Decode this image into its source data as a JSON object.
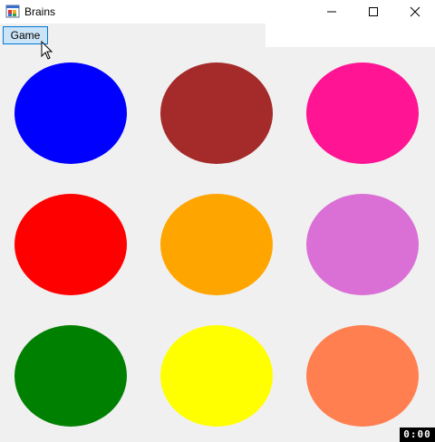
{
  "window": {
    "title": "Brains",
    "icon": "windows-forms-app-icon",
    "controls": [
      "minimize-icon",
      "maximize-icon",
      "close-icon"
    ]
  },
  "menu": {
    "game_label": "Game"
  },
  "circles": [
    {
      "name": "circle-blue",
      "color": "#0000ff"
    },
    {
      "name": "circle-brown",
      "color": "#a52a2a"
    },
    {
      "name": "circle-deep-pink",
      "color": "#ff1493"
    },
    {
      "name": "circle-red",
      "color": "#ff0000"
    },
    {
      "name": "circle-orange",
      "color": "#ffa500"
    },
    {
      "name": "circle-orchid",
      "color": "#da70d6"
    },
    {
      "name": "circle-green",
      "color": "#008000"
    },
    {
      "name": "circle-yellow",
      "color": "#ffff00"
    },
    {
      "name": "circle-coral",
      "color": "#ff7f50"
    }
  ],
  "timer": {
    "value": "0:00"
  },
  "colors": {
    "menu_highlight": "#cce4f7",
    "menu_border": "#0078d7",
    "background": "#f0f0f0"
  }
}
